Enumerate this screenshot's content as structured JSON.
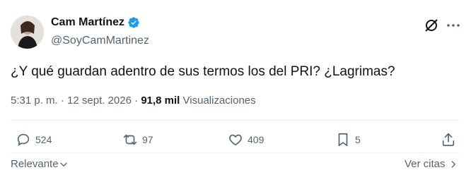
{
  "author": {
    "name": "Cam Martínez",
    "handle": "@SoyCamMartinez",
    "verified": true
  },
  "tweet": {
    "text": "¿Y qué guardan adentro de sus termos los del PRI? ¿Lagrimas?",
    "time": "5:31 p. m.",
    "separator": "·",
    "date": "12 sept. 2026",
    "views_count": "91,8 mil",
    "views_label": "Visualizaciones"
  },
  "actions": {
    "replies": "524",
    "reposts": "97",
    "likes": "409",
    "bookmarks": "5"
  },
  "footer": {
    "sort_label": "Relevante",
    "quotes_label": "Ver citas"
  },
  "colors": {
    "text": "#0f1419",
    "secondary": "#536471",
    "verified": "#1d9bf0",
    "divider": "#eff3f4"
  }
}
